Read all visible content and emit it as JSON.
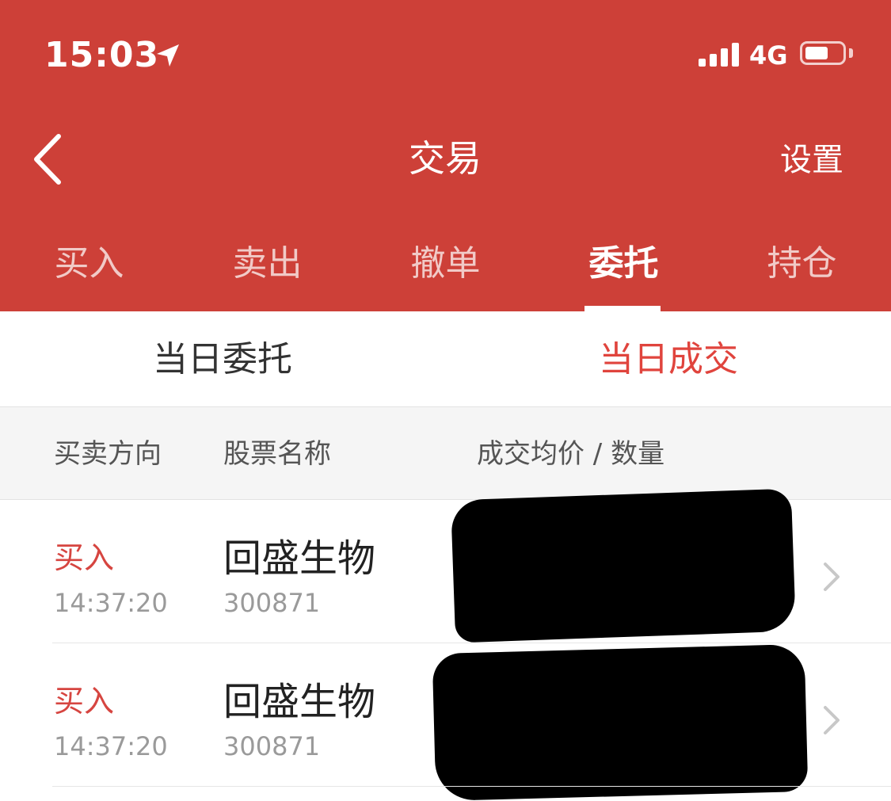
{
  "status_bar": {
    "time": "15:03",
    "network": "4G"
  },
  "nav": {
    "title": "交易",
    "settings_label": "设置"
  },
  "tabs": [
    {
      "label": "买入",
      "active": false
    },
    {
      "label": "卖出",
      "active": false
    },
    {
      "label": "撤单",
      "active": false
    },
    {
      "label": "委托",
      "active": true
    },
    {
      "label": "持仓",
      "active": false
    }
  ],
  "subtabs": [
    {
      "label": "当日委托",
      "active": false
    },
    {
      "label": "当日成交",
      "active": true
    }
  ],
  "table": {
    "headers": {
      "direction": "买卖方向",
      "stock_name": "股票名称",
      "avg_price_qty": "成交均价 / 数量"
    },
    "rows": [
      {
        "direction": "买入",
        "time": "14:37:20",
        "name": "回盛生物",
        "code": "300871"
      },
      {
        "direction": "买入",
        "time": "14:37:20",
        "name": "回盛生物",
        "code": "300871"
      }
    ]
  },
  "colors": {
    "brand_red": "#cd4038",
    "accent_red": "#d64540",
    "active_subtab": "#e0443d",
    "inactive_subtab": "#333333"
  },
  "icons": {
    "back": "chevron-left-icon",
    "location": "location-arrow-icon",
    "row_chevron": "chevron-right-icon"
  }
}
